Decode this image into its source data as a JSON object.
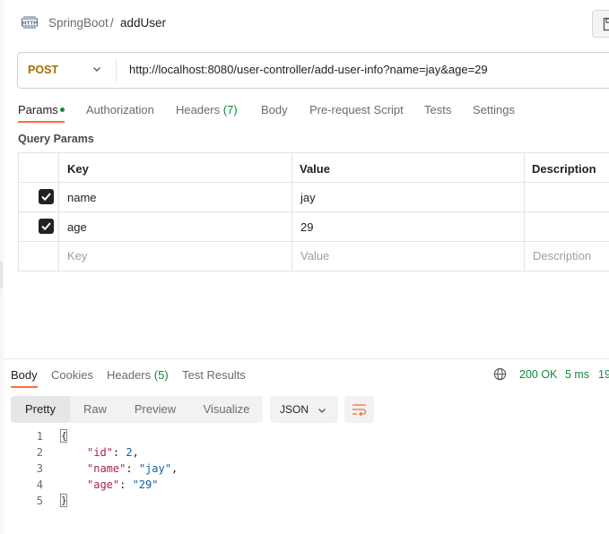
{
  "header": {
    "collection": "SpringBoot",
    "separator": "/",
    "request_name": "addUser",
    "icons": {
      "request_type": "http-icon",
      "save": "save-icon"
    }
  },
  "url_bar": {
    "method": "POST",
    "url": "http://localhost:8080/user-controller/add-user-info?name=jay&age=29"
  },
  "request_tabs": [
    {
      "label": "Params",
      "active": true
    },
    {
      "label": "Authorization"
    },
    {
      "label": "Headers",
      "count": "(7)"
    },
    {
      "label": "Body"
    },
    {
      "label": "Pre-request Script"
    },
    {
      "label": "Tests"
    },
    {
      "label": "Settings"
    }
  ],
  "query_params": {
    "title": "Query Params",
    "columns": [
      "Key",
      "Value",
      "Description"
    ],
    "rows": [
      {
        "checked": true,
        "key": "name",
        "value": "jay",
        "description": ""
      },
      {
        "checked": true,
        "key": "age",
        "value": "29",
        "description": ""
      }
    ],
    "placeholder": {
      "key": "Key",
      "value": "Value",
      "description": "Description"
    }
  },
  "response": {
    "tabs": [
      {
        "label": "Body",
        "active": true
      },
      {
        "label": "Cookies"
      },
      {
        "label": "Headers",
        "count": "(5)"
      },
      {
        "label": "Test Results"
      }
    ],
    "status": "200 OK",
    "time": "5 ms",
    "size": "19",
    "view_modes": [
      "Pretty",
      "Raw",
      "Preview",
      "Visualize"
    ],
    "active_view": "Pretty",
    "format": "JSON",
    "line_numbers": [
      "1",
      "2",
      "3",
      "4",
      "5"
    ],
    "body": {
      "open": "{",
      "close": "}",
      "lines": [
        {
          "key": "\"id\"",
          "value": "2"
        },
        {
          "key": "\"name\"",
          "value": "\"jay\""
        },
        {
          "key": "\"age\"",
          "value": "\"29\""
        }
      ]
    }
  },
  "colors": {
    "accent": "#ff6c37",
    "method": "#a76d00",
    "success": "#128a3b",
    "json_key": "#a8254a",
    "json_value": "#0f5fa8"
  }
}
